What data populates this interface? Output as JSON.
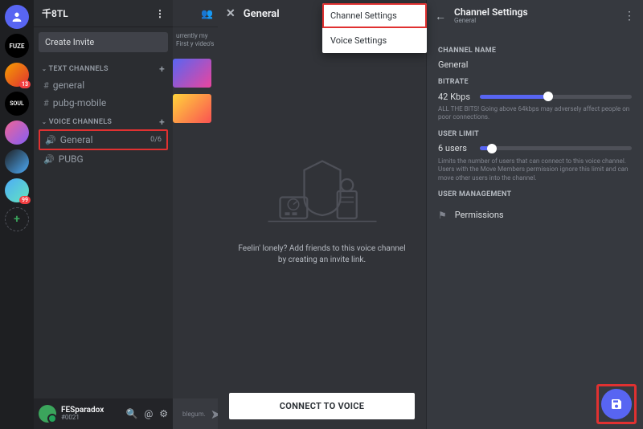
{
  "server_rail": {
    "items": [
      {
        "name": "home",
        "label": "",
        "badge": ""
      },
      {
        "name": "fuze",
        "label": "FUZE",
        "badge": ""
      },
      {
        "name": "s2",
        "label": "",
        "badge": "13"
      },
      {
        "name": "soul",
        "label": "SOUL",
        "badge": ""
      },
      {
        "name": "s4",
        "label": "",
        "badge": ""
      },
      {
        "name": "s5",
        "label": "",
        "badge": ""
      },
      {
        "name": "s6",
        "label": "",
        "badge": "99"
      }
    ]
  },
  "sidebar": {
    "server_name": "千8TL",
    "create_invite": "Create Invite",
    "text_heading": "TEXT CHANNELS",
    "voice_heading": "VOICE CHANNELS",
    "text_channels": [
      {
        "name": "general"
      },
      {
        "name": "pubg-mobile"
      }
    ],
    "voice_channels": [
      {
        "name": "General",
        "cap": "0/6"
      },
      {
        "name": "PUBG",
        "cap": ""
      }
    ],
    "user": {
      "name": "FESparadox",
      "tag": "#0021"
    }
  },
  "feed": {
    "snippet": "urrently my First y video's",
    "footer_placeholder": "blegum."
  },
  "mid": {
    "title": "General",
    "menu": [
      {
        "label": "Channel Settings",
        "highlight": true
      },
      {
        "label": "Voice Settings",
        "highlight": false
      }
    ],
    "lonely": "Feelin' lonely? Add friends to this voice channel by creating an invite link.",
    "connect": "CONNECT TO VOICE"
  },
  "panel": {
    "title": "Channel Settings",
    "subtitle": "General",
    "labels": {
      "channel_name": "CHANNEL NAME",
      "bitrate": "BITRATE",
      "user_limit": "USER LIMIT",
      "user_mgmt": "USER MANAGEMENT"
    },
    "channel_name_value": "General",
    "bitrate_value": "42 Kbps",
    "bitrate_hint": "ALL THE BITS! Going above 64kbps may adversely affect people on poor connections.",
    "userlimit_value": "6 users",
    "userlimit_hint": "Limits the number of users that can connect to this voice channel. Users with the Move Members permission ignore this limit and can move other users into the channel.",
    "permissions": "Permissions"
  }
}
